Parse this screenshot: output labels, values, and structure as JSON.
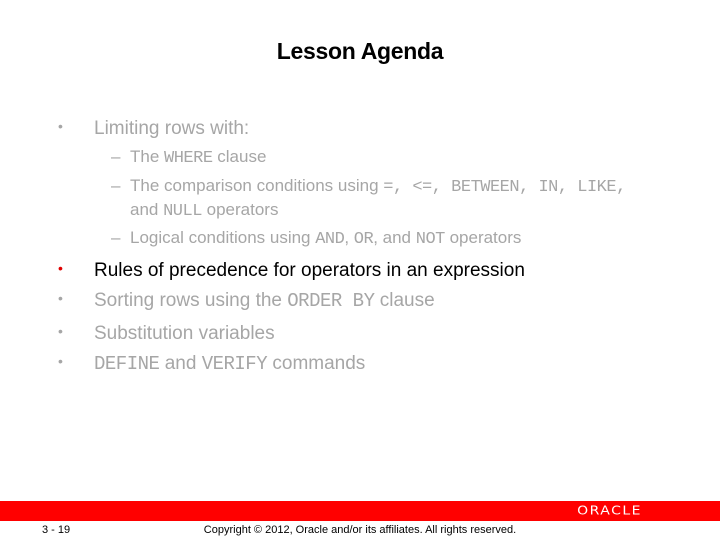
{
  "slide": {
    "title": "Lesson Agenda",
    "items": [
      {
        "bullet": "•",
        "parts": [
          "Limiting rows with:"
        ],
        "active": false,
        "subitems": [
          {
            "dash": "–",
            "pre": "The ",
            "code1": "WHERE",
            "post": " clause"
          },
          {
            "dash": "–",
            "line1_pre": "The comparison conditions using ",
            "line1_code": "=, <=, BETWEEN, IN, LIKE,",
            "line2_pre": "and ",
            "line2_code": "NULL",
            "line2_post": " operators"
          },
          {
            "dash": "–",
            "pre": "Logical conditions using ",
            "code1": "AND",
            "mid1": ", ",
            "code2": "OR",
            "mid2": ", and ",
            "code3": "NOT",
            "post": " operators"
          }
        ]
      },
      {
        "bullet": "•",
        "text": "Rules of precedence for operators in an expression",
        "active": true
      },
      {
        "bullet": "•",
        "pre": "Sorting rows using the ",
        "code": "ORDER BY",
        "post": " clause",
        "active": false
      },
      {
        "bullet": "•",
        "text": "Substitution variables",
        "active": false
      },
      {
        "bullet": "•",
        "code1": "DEFINE",
        "mid": " and ",
        "code2": "VERIFY",
        "post": " commands",
        "active": false
      }
    ]
  },
  "footer": {
    "page_number": "3 - 19",
    "copyright": "Copyright © 2012, Oracle and/or its affiliates. All rights reserved.",
    "logo_text": "ORACLE",
    "bar_color": "#ff0000",
    "accent_bullet_color": "#e00000"
  }
}
